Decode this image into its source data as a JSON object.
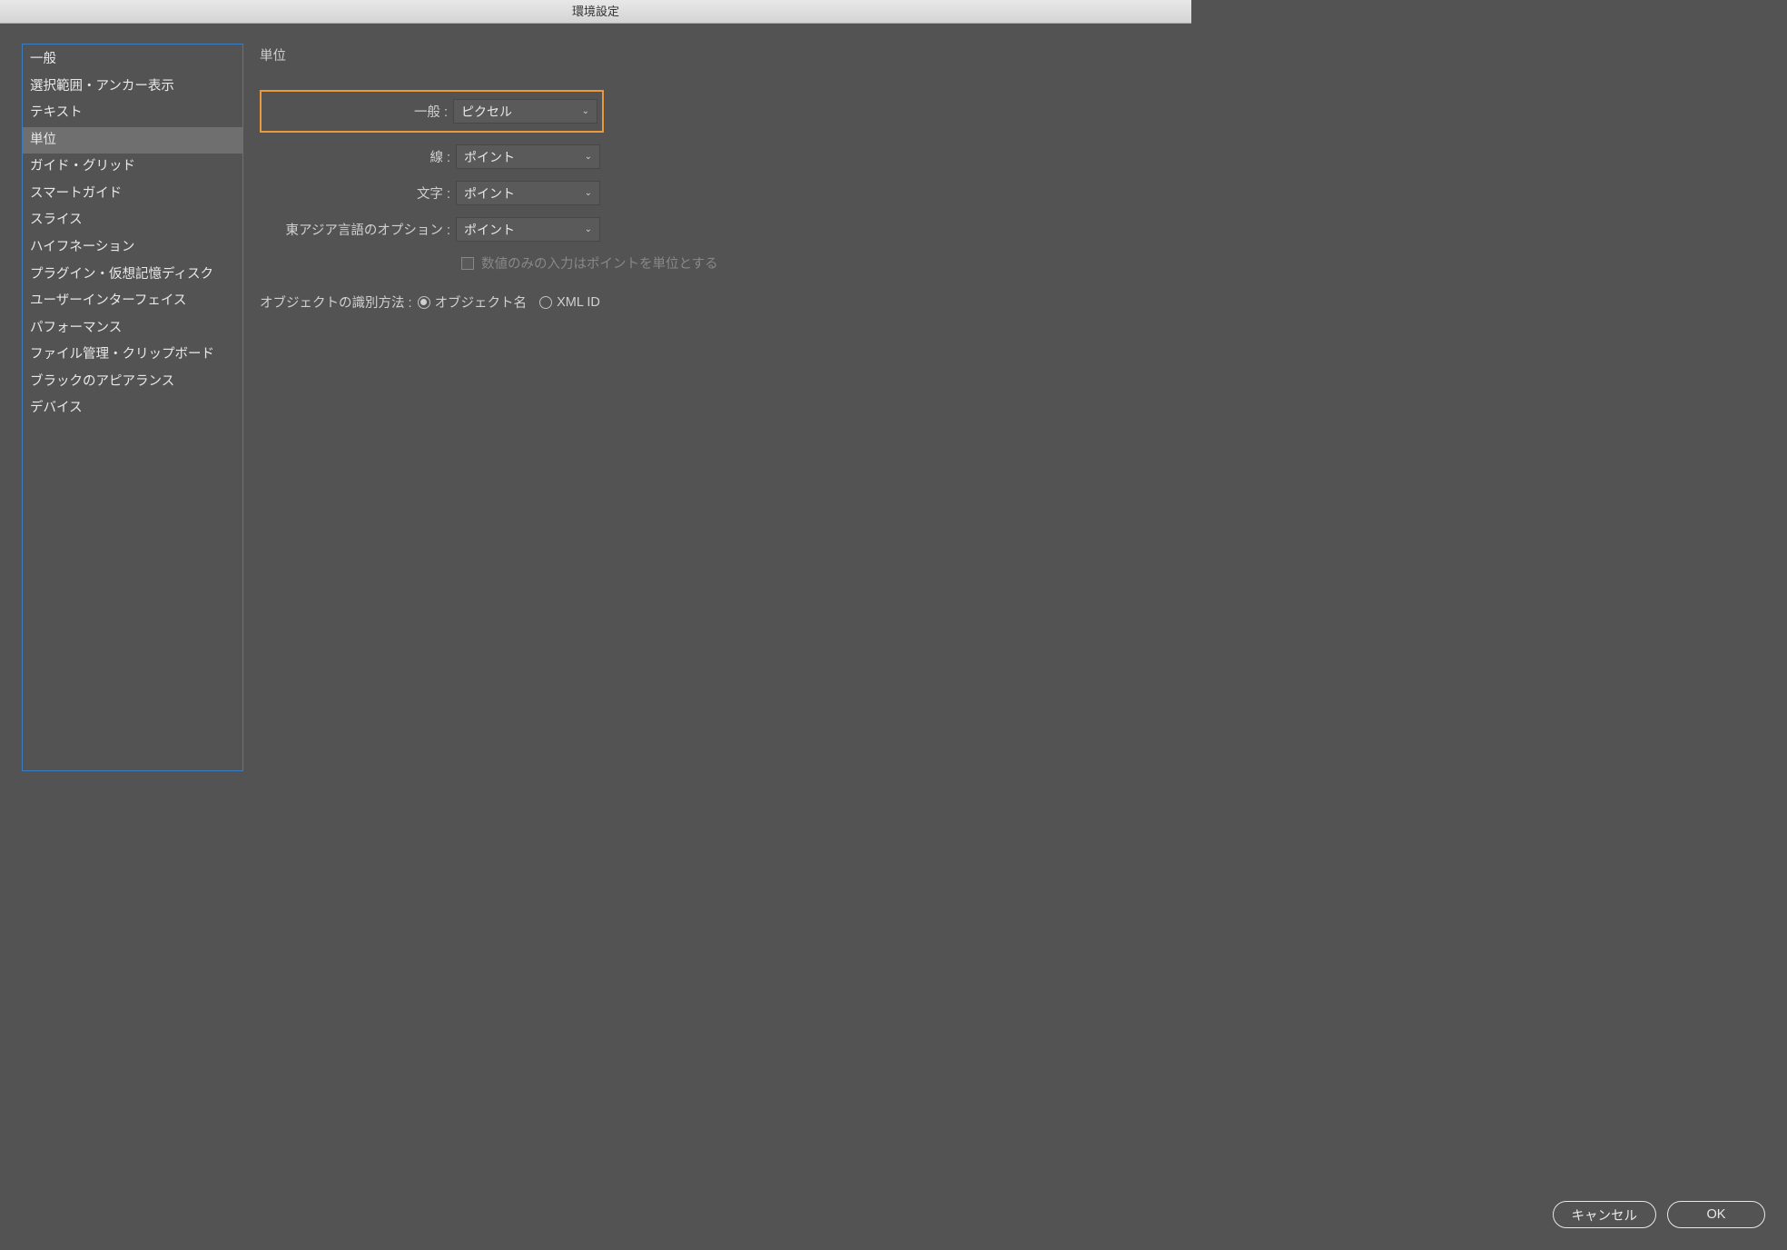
{
  "window": {
    "title": "環境設定"
  },
  "sidebar": {
    "items": [
      {
        "label": "一般"
      },
      {
        "label": "選択範囲・アンカー表示"
      },
      {
        "label": "テキスト"
      },
      {
        "label": "単位"
      },
      {
        "label": "ガイド・グリッド"
      },
      {
        "label": "スマートガイド"
      },
      {
        "label": "スライス"
      },
      {
        "label": "ハイフネーション"
      },
      {
        "label": "プラグイン・仮想記憶ディスク"
      },
      {
        "label": "ユーザーインターフェイス"
      },
      {
        "label": "パフォーマンス"
      },
      {
        "label": "ファイル管理・クリップボード"
      },
      {
        "label": "ブラックのアピアランス"
      },
      {
        "label": "デバイス"
      }
    ],
    "selected_index": 3
  },
  "panel": {
    "title": "単位",
    "general": {
      "label": "一般 :",
      "value": "ピクセル"
    },
    "stroke": {
      "label": "線 :",
      "value": "ポイント"
    },
    "type": {
      "label": "文字 :",
      "value": "ポイント"
    },
    "east_asian": {
      "label": "東アジア言語のオプション :",
      "value": "ポイント"
    },
    "checkbox_label": "数値のみの入力はポイントを単位とする",
    "identify": {
      "label": "オブジェクトの識別方法 :",
      "option1": "オブジェクト名",
      "option2": "XML ID",
      "selected": 0
    }
  },
  "buttons": {
    "cancel": "キャンセル",
    "ok": "OK"
  }
}
